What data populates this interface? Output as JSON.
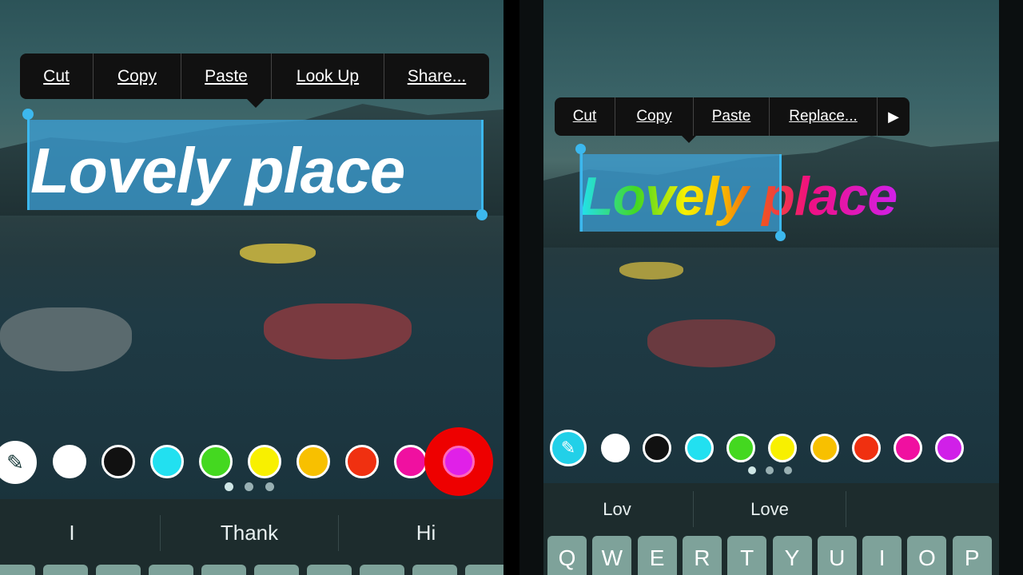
{
  "left": {
    "menu": [
      "Cut",
      "Copy",
      "Paste",
      "Look Up",
      "Share..."
    ],
    "text": "Lovely place",
    "selection_color": "#3ca0d7",
    "palette": [
      "eyedropper",
      "#ffffff",
      "#111111",
      "#22e0f0",
      "#44d820",
      "#f8f000",
      "#f8c000",
      "#f03010",
      "#f010a0",
      "#e020e8"
    ],
    "selected_color": "#e020e8",
    "page_dots": 3,
    "suggestions": [
      "I",
      "Thank",
      "Hi"
    ]
  },
  "right": {
    "menu": [
      "Cut",
      "Copy",
      "Paste",
      "Replace..."
    ],
    "menu_more": "▶",
    "text": "Lovely place",
    "selection_text": "Lovely",
    "palette": [
      "eyedropper",
      "#ffffff",
      "#111111",
      "#22e0f0",
      "#44d820",
      "#f8f000",
      "#f8c000",
      "#f03010",
      "#f010a0",
      "#d020e8"
    ],
    "page_dots": 3,
    "suggestions": [
      "Lov",
      "Love",
      ""
    ],
    "keys": [
      "Q",
      "W",
      "E",
      "R",
      "T",
      "Y",
      "U",
      "I",
      "O",
      "P"
    ]
  }
}
